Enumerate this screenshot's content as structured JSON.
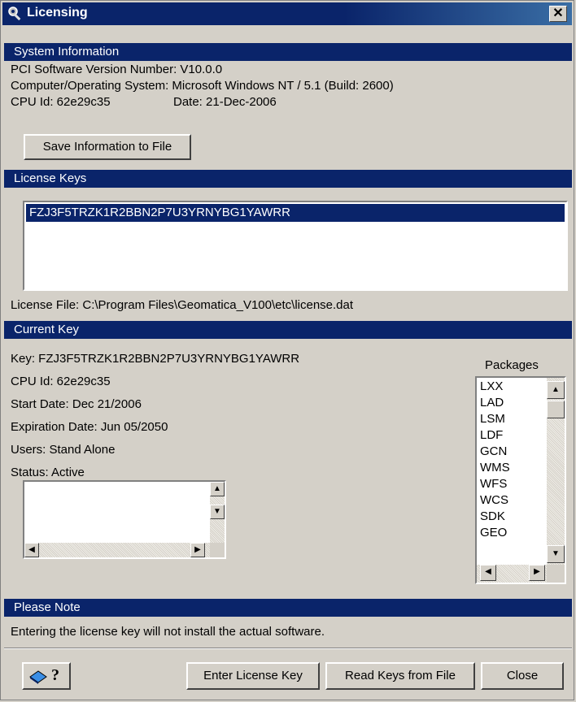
{
  "window": {
    "title": "Licensing",
    "close_label": "✕"
  },
  "system": {
    "header": "System Information",
    "version_line": "PCI Software Version Number: V10.0.0",
    "os_line": "Computer/Operating System: Microsoft Windows NT / 5.1 (Build: 2600)",
    "cpu_line": "CPU Id: 62e29c35",
    "date_line": "Date: 21-Dec-2006",
    "save_button": "Save Information to File"
  },
  "license_keys": {
    "header": "License Keys",
    "items": [
      "FZJ3F5TRZK1R2BBN2P7U3YRNYBG1YAWRR"
    ],
    "license_file": "License File: C:\\Program Files\\Geomatica_V100\\etc\\license.dat"
  },
  "current_key": {
    "header": "Current Key",
    "key": "Key: FZJ3F5TRZK1R2BBN2P7U3YRNYBG1YAWRR",
    "cpu": "CPU Id: 62e29c35",
    "start": "Start Date: Dec 21/2006",
    "expiration": "Expiration Date: Jun 05/2050",
    "users": "Users: Stand Alone",
    "status": "Status: Active",
    "packages_label": "Packages",
    "packages": [
      "LXX",
      "LAD",
      "LSM",
      "LDF",
      "GCN",
      "WMS",
      "WFS",
      "WCS",
      "SDK",
      "GEO"
    ]
  },
  "note": {
    "header": "Please Note",
    "text": "Entering the license key will not install the actual software."
  },
  "footer": {
    "enter_key": "Enter License Key",
    "read_keys": "Read Keys from File",
    "close": "Close",
    "help_label": "?"
  }
}
